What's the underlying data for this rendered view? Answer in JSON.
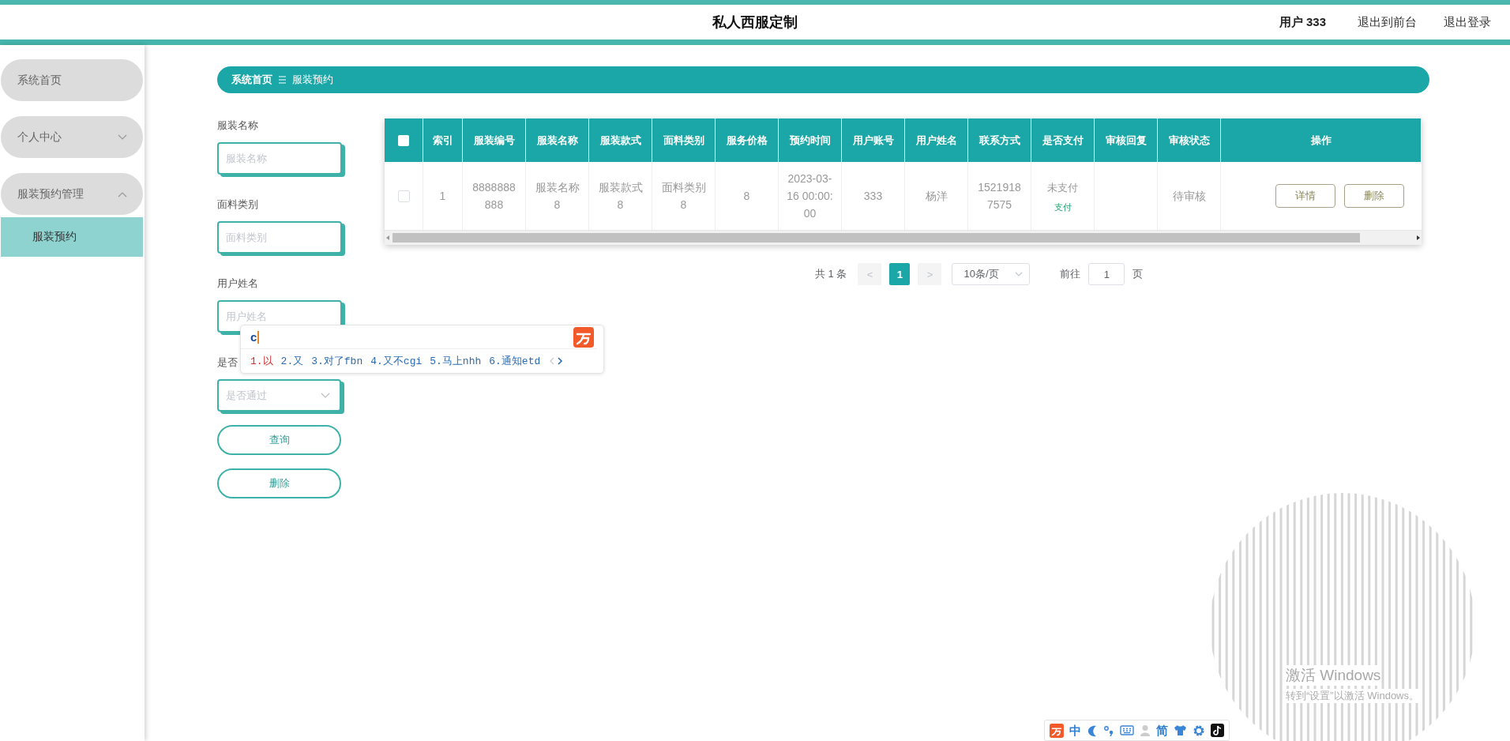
{
  "header": {
    "title": "私人西服定制",
    "user": "用户 333",
    "links": [
      "退出到前台",
      "退出登录"
    ]
  },
  "sidebar": {
    "items": [
      {
        "label": "系统首页",
        "kind": "link",
        "selected": false
      },
      {
        "label": "个人中心",
        "kind": "group",
        "expanded": false,
        "selected": false
      },
      {
        "label": "服装预约管理",
        "kind": "group",
        "expanded": true,
        "selected": false,
        "children": [
          {
            "label": "服装预约",
            "selected": true
          }
        ]
      }
    ]
  },
  "breadcrumb": [
    "系统首页",
    "服装预约"
  ],
  "filters": {
    "fields": [
      {
        "label": "服装名称",
        "kind": "text",
        "placeholder": "服装名称"
      },
      {
        "label": "面料类别",
        "kind": "text",
        "placeholder": "面料类别"
      },
      {
        "label": "用户姓名",
        "kind": "text",
        "placeholder": "用户姓名"
      },
      {
        "label": "是否",
        "kind": "select",
        "placeholder": "是否通过"
      }
    ],
    "buttons": [
      "查询",
      "删除"
    ]
  },
  "table": {
    "select_all": false,
    "columns": [
      "索引",
      "服装编号",
      "服装名称",
      "服装款式",
      "面料类别",
      "服务价格",
      "预约时间",
      "用户账号",
      "用户姓名",
      "联系方式",
      "是否支付",
      "审核回复",
      "审核状态",
      "操作"
    ],
    "rows": [
      {
        "checked": false,
        "cells": [
          "1",
          "8888888888",
          "服装名称8",
          "服装款式8",
          "面料类别8",
          "8",
          "2023-03-16 00:00:00",
          "333",
          "杨洋",
          "15219187575"
        ],
        "payment": {
          "status": "未支付",
          "action": "支付"
        },
        "review_status": "待审核",
        "actions": [
          "详情",
          "删除"
        ]
      }
    ]
  },
  "pagination": {
    "total": "共 1 条",
    "prev": "<",
    "pages": [
      {
        "label": "1",
        "selected": true
      }
    ],
    "next": ">",
    "page_size": "10条/页",
    "goto": "前往",
    "goto_value": "1",
    "goto_unit": "页"
  },
  "ime_popup": {
    "input": "c",
    "candidates": [
      {
        "label": "1.以",
        "selected": true
      },
      {
        "label": "2.又",
        "selected": false
      },
      {
        "label": "3.对了fbn",
        "selected": false
      },
      {
        "label": "4.又不cgi",
        "selected": false
      },
      {
        "label": "5.马上nhh",
        "selected": false
      },
      {
        "label": "6.通知etd",
        "selected": false
      }
    ]
  },
  "ime_toolbar": {
    "mode": "中",
    "script": "简"
  },
  "os_notice": {
    "title": "激活 Windows",
    "hint": "转到“设置”以激活 Windows。"
  }
}
